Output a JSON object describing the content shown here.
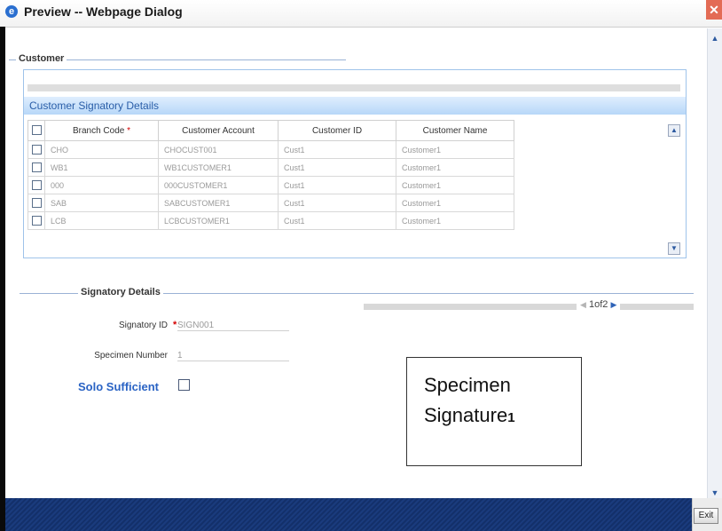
{
  "window": {
    "title": "Preview -- Webpage Dialog",
    "close_glyph": "✕",
    "icon": "ie-icon"
  },
  "customer_section": {
    "title": "Customer"
  },
  "signatory_grid": {
    "header": "Customer Signatory Details",
    "columns": [
      "Branch Code",
      "Customer Account",
      "Customer ID",
      "Customer Name"
    ],
    "required_marker": "*",
    "rows": [
      {
        "branch": "CHO",
        "account": "CHOCUST001",
        "id": "Cust1",
        "name": "Customer1"
      },
      {
        "branch": "WB1",
        "account": "WB1CUSTOMER1",
        "id": "Cust1",
        "name": "Customer1"
      },
      {
        "branch": "000",
        "account": "000CUSTOMER1",
        "id": "Cust1",
        "name": "Customer1"
      },
      {
        "branch": "SAB",
        "account": "SABCUSTOMER1",
        "id": "Cust1",
        "name": "Customer1"
      },
      {
        "branch": "LCB",
        "account": "LCBCUSTOMER1",
        "id": "Cust1",
        "name": "Customer1"
      }
    ]
  },
  "signatory_details": {
    "title": "Signatory Details",
    "pager": {
      "text": "1of2"
    },
    "signatory_id_label": "Signatory ID",
    "signatory_id_required": "*",
    "signatory_id_value": "SIGN001",
    "specimen_number_label": "Specimen Number",
    "specimen_number_value": "1",
    "solo_sufficient_label": "Solo Sufficient"
  },
  "specimen": {
    "line1": "Specimen",
    "line2": "Signature",
    "number": "1"
  },
  "footer": {
    "exit_label": "Exit"
  },
  "colors": {
    "accent": "#2a63c4",
    "footer": "#13306a",
    "grid_header": "#b7d7f8",
    "required": "#d40000"
  }
}
